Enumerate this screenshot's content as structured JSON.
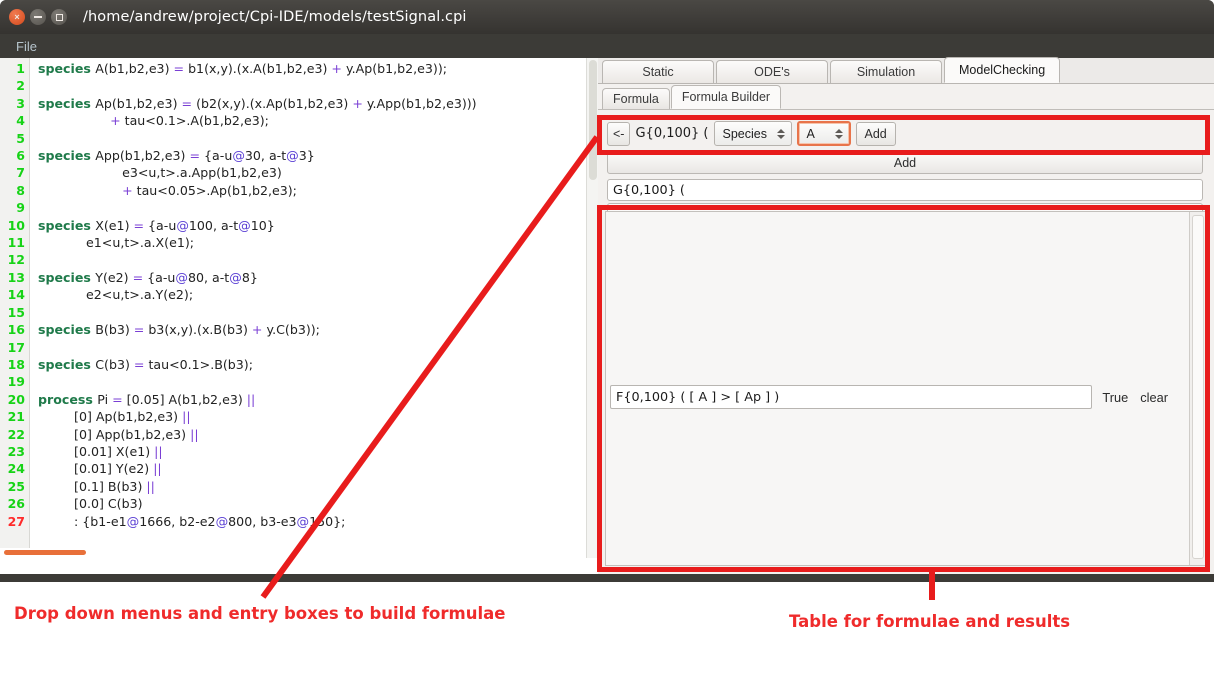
{
  "window": {
    "title": "/home/andrew/project/Cpi-IDE/models/testSignal.cpi",
    "close_label": "×",
    "menu": {
      "file": "File"
    }
  },
  "editor": {
    "lines": [
      {
        "n": "1",
        "segments": [
          {
            "t": "kw",
            "s": "species "
          },
          {
            "t": "p",
            "s": "A(b1,b2,e3) "
          },
          {
            "t": "op",
            "s": "= "
          },
          {
            "t": "p",
            "s": "b1(x,y).(x.A(b1,b2,e3) "
          },
          {
            "t": "op",
            "s": "+ "
          },
          {
            "t": "p",
            "s": "y.Ap(b1,b2,e3));"
          }
        ]
      },
      {
        "n": "2",
        "segments": []
      },
      {
        "n": "3",
        "segments": [
          {
            "t": "kw",
            "s": "species "
          },
          {
            "t": "p",
            "s": "Ap(b1,b2,e3) "
          },
          {
            "t": "op",
            "s": "= "
          },
          {
            "t": "p",
            "s": "(b2(x,y).(x.Ap(b1,b2,e3) "
          },
          {
            "t": "op",
            "s": "+ "
          },
          {
            "t": "p",
            "s": "y.App(b1,b2,e3)))"
          }
        ]
      },
      {
        "n": "4",
        "segments": [
          {
            "t": "p",
            "s": "                  "
          },
          {
            "t": "op",
            "s": "+ "
          },
          {
            "t": "p",
            "s": "tau<0.1>.A(b1,b2,e3);"
          }
        ]
      },
      {
        "n": "5",
        "segments": []
      },
      {
        "n": "6",
        "segments": [
          {
            "t": "kw",
            "s": "species "
          },
          {
            "t": "p",
            "s": "App(b1,b2,e3) "
          },
          {
            "t": "op",
            "s": "= "
          },
          {
            "t": "p",
            "s": "{a-u"
          },
          {
            "t": "at",
            "s": "@"
          },
          {
            "t": "p",
            "s": "30, a-t"
          },
          {
            "t": "at",
            "s": "@"
          },
          {
            "t": "p",
            "s": "3}"
          }
        ]
      },
      {
        "n": "7",
        "segments": [
          {
            "t": "p",
            "s": "                     e3<u,t>.a.App(b1,b2,e3)"
          }
        ]
      },
      {
        "n": "8",
        "segments": [
          {
            "t": "p",
            "s": "                     "
          },
          {
            "t": "op",
            "s": "+ "
          },
          {
            "t": "p",
            "s": "tau<0.05>.Ap(b1,b2,e3);"
          }
        ]
      },
      {
        "n": "9",
        "segments": []
      },
      {
        "n": "10",
        "segments": [
          {
            "t": "kw",
            "s": "species "
          },
          {
            "t": "p",
            "s": "X(e1) "
          },
          {
            "t": "op",
            "s": "= "
          },
          {
            "t": "p",
            "s": "{a-u"
          },
          {
            "t": "at",
            "s": "@"
          },
          {
            "t": "p",
            "s": "100, a-t"
          },
          {
            "t": "at",
            "s": "@"
          },
          {
            "t": "p",
            "s": "10}"
          }
        ]
      },
      {
        "n": "11",
        "segments": [
          {
            "t": "p",
            "s": "            e1<u,t>.a.X(e1);"
          }
        ]
      },
      {
        "n": "12",
        "segments": []
      },
      {
        "n": "13",
        "segments": [
          {
            "t": "kw",
            "s": "species "
          },
          {
            "t": "p",
            "s": "Y(e2) "
          },
          {
            "t": "op",
            "s": "= "
          },
          {
            "t": "p",
            "s": "{a-u"
          },
          {
            "t": "at",
            "s": "@"
          },
          {
            "t": "p",
            "s": "80, a-t"
          },
          {
            "t": "at",
            "s": "@"
          },
          {
            "t": "p",
            "s": "8}"
          }
        ]
      },
      {
        "n": "14",
        "segments": [
          {
            "t": "p",
            "s": "            e2<u,t>.a.Y(e2);"
          }
        ]
      },
      {
        "n": "15",
        "segments": []
      },
      {
        "n": "16",
        "segments": [
          {
            "t": "kw",
            "s": "species "
          },
          {
            "t": "p",
            "s": "B(b3) "
          },
          {
            "t": "op",
            "s": "= "
          },
          {
            "t": "p",
            "s": "b3(x,y).(x.B(b3) "
          },
          {
            "t": "op",
            "s": "+ "
          },
          {
            "t": "p",
            "s": "y.C(b3));"
          }
        ]
      },
      {
        "n": "17",
        "segments": []
      },
      {
        "n": "18",
        "segments": [
          {
            "t": "kw",
            "s": "species "
          },
          {
            "t": "p",
            "s": "C(b3) "
          },
          {
            "t": "op",
            "s": "= "
          },
          {
            "t": "p",
            "s": "tau<0.1>.B(b3);"
          }
        ]
      },
      {
        "n": "19",
        "segments": []
      },
      {
        "n": "20",
        "segments": [
          {
            "t": "kw",
            "s": "process "
          },
          {
            "t": "p",
            "s": "Pi "
          },
          {
            "t": "op",
            "s": "= "
          },
          {
            "t": "p",
            "s": "[0.05] A(b1,b2,e3) "
          },
          {
            "t": "op",
            "s": "||"
          }
        ]
      },
      {
        "n": "21",
        "segments": [
          {
            "t": "p",
            "s": "         [0] Ap(b1,b2,e3) "
          },
          {
            "t": "op",
            "s": "||"
          }
        ]
      },
      {
        "n": "22",
        "segments": [
          {
            "t": "p",
            "s": "         [0] App(b1,b2,e3) "
          },
          {
            "t": "op",
            "s": "||"
          }
        ]
      },
      {
        "n": "23",
        "segments": [
          {
            "t": "p",
            "s": "         [0.01] X(e1) "
          },
          {
            "t": "op",
            "s": "||"
          }
        ]
      },
      {
        "n": "24",
        "segments": [
          {
            "t": "p",
            "s": "         [0.01] Y(e2) "
          },
          {
            "t": "op",
            "s": "||"
          }
        ]
      },
      {
        "n": "25",
        "segments": [
          {
            "t": "p",
            "s": "         [0.1] B(b3) "
          },
          {
            "t": "op",
            "s": "||"
          }
        ]
      },
      {
        "n": "26",
        "segments": [
          {
            "t": "p",
            "s": "         [0.0] C(b3)"
          }
        ]
      },
      {
        "n": "27",
        "segments": [
          {
            "t": "p",
            "s": "         : {b1-e1"
          },
          {
            "t": "at",
            "s": "@"
          },
          {
            "t": "p",
            "s": "1666, b2-e2"
          },
          {
            "t": "at",
            "s": "@"
          },
          {
            "t": "p",
            "s": "800, b3-e3"
          },
          {
            "t": "at",
            "s": "@"
          },
          {
            "t": "p",
            "s": "150};"
          }
        ],
        "error": true
      }
    ]
  },
  "panel": {
    "tabs": [
      {
        "label": "Static",
        "active": false
      },
      {
        "label": "ODE's",
        "active": false
      },
      {
        "label": "Simulation",
        "active": false
      },
      {
        "label": "ModelChecking",
        "active": true
      }
    ],
    "subtabs": [
      {
        "label": "Formula",
        "active": false
      },
      {
        "label": "Formula Builder",
        "active": true
      }
    ],
    "builder": {
      "back_label": "<-",
      "prefix_label": "G{0,100} (",
      "type_combo": "Species",
      "species_combo": "A",
      "add_label": "Add"
    },
    "add_bar_label": "Add",
    "formula_field_value": "G{0,100} (",
    "table": {
      "rows": [
        {
          "formula": "F{0,100} ( [ A ] > [ Ap ] )",
          "result": "True",
          "clear_label": "clear"
        }
      ]
    }
  },
  "annotations": {
    "left": "Drop down menus and entry boxes to build formulae",
    "right": "Table for formulae and results",
    "color": "#ef2b2b"
  }
}
